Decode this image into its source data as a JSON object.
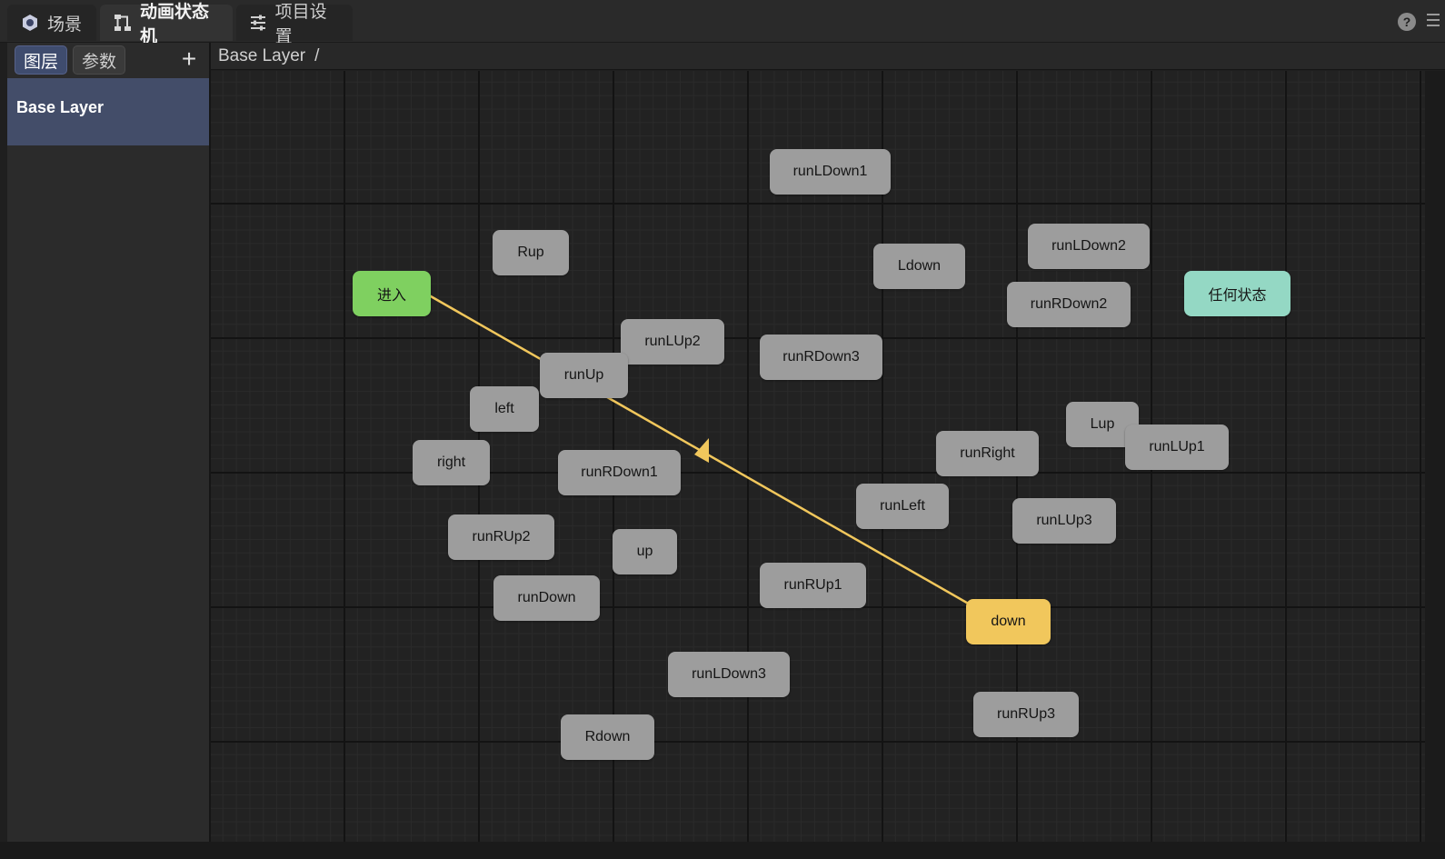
{
  "tabs": [
    {
      "label": "场景",
      "icon": "scene-icon"
    },
    {
      "label": "动画状态机",
      "icon": "state-machine-icon"
    },
    {
      "label": "项目设置",
      "icon": "settings-sliders-icon"
    }
  ],
  "left_panel": {
    "tabs": [
      "图层",
      "参数"
    ],
    "add_label": "+",
    "layers": [
      "Base Layer"
    ]
  },
  "breadcrumb": {
    "path": "Base Layer",
    "separator": "/"
  },
  "colors": {
    "state": "#9d9d9d",
    "entry": "#7fd060",
    "any_state": "#94d8c4",
    "default_state": "#f1c75c",
    "transition": "#f1c75c",
    "active_layer": "#434d69"
  },
  "states": {
    "runLDown1": "runLDown1",
    "Rup": "Rup",
    "Ldown": "Ldown",
    "runLDown2": "runLDown2",
    "entry": "进入",
    "runRDown2": "runRDown2",
    "any_state": "任何状态",
    "runLUp2": "runLUp2",
    "runRDown3": "runRDown3",
    "runUp": "runUp",
    "left": "left",
    "Lup": "Lup",
    "runLUp1": "runLUp1",
    "runRight": "runRight",
    "right": "right",
    "runRDown1": "runRDown1",
    "runLeft": "runLeft",
    "runLUp3": "runLUp3",
    "runRUp2": "runRUp2",
    "up": "up",
    "runRUp1": "runRUp1",
    "runDown": "runDown",
    "down": "down",
    "runLDown3": "runLDown3",
    "runRUp3": "runRUp3",
    "Rdown": "Rdown"
  }
}
